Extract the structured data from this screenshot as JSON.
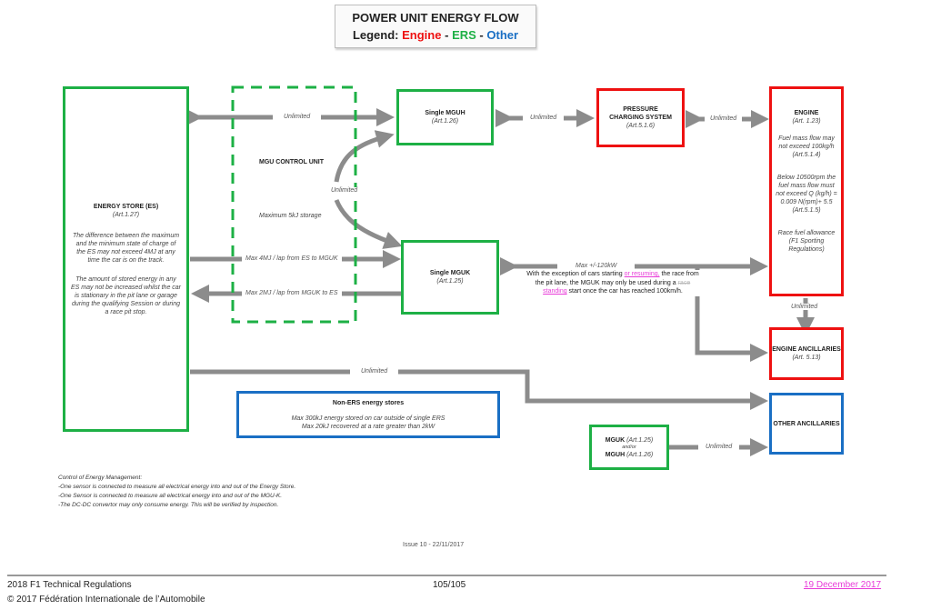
{
  "header": {
    "title": "POWER UNIT ENERGY FLOW",
    "legend_label": "Legend:",
    "legend_engine": "Engine",
    "legend_ers": "ERS",
    "legend_other": "Other",
    "separator": "-",
    "colors": {
      "engine": "#ee1111",
      "ers": "#1db045",
      "other": "#1a6fc4",
      "arrow": "#8c8c8c"
    }
  },
  "nodes": {
    "energy_store": {
      "title": "ENERGY STORE (ES)",
      "article": "(Art.1.27)",
      "note1": "The difference between the maximum and the minimum state of charge of the ES may not exceed 4MJ at any time the car is on the track.",
      "note2": "The amount of stored energy in any ES may not be increased whilst the car is stationary in the pit lane or garage during the qualifying Session or during a race pit stop."
    },
    "mgu_control_unit": {
      "title": "MGU CONTROL UNIT",
      "note": "Maximum 5kJ storage"
    },
    "mguh": {
      "title": "Single MGUH",
      "article": "(Art.1.26)"
    },
    "mguk": {
      "title": "Single MGUK",
      "article": "(Art.1.25)"
    },
    "pressure_charging": {
      "title": "PRESSURE CHARGING SYSTEM",
      "article": "(Art.5.1.6)"
    },
    "engine": {
      "title": "ENGINE",
      "article": "(Art. 1.23)",
      "note1": "Fuel mass flow may not exceed 100kg/h (Art.5.1.4)",
      "note2": "Below 10500rpm the fuel mass flow must not exceed Q (kg/h) = 0.009 N(rpm)+ 5.5 (Art.5.1.5)",
      "note3": "Race fuel allowance (F1 Sporting Regulations)"
    },
    "engine_ancillaries": {
      "title": "ENGINE ANCILLARIES",
      "article": "(Art. 5.13)"
    },
    "non_ers": {
      "title": "Non-ERS energy stores",
      "line1": "Max 300kJ energy stored on car outside of single ERS",
      "line2": "Max 20kJ recovered at a rate greater than 2kW"
    },
    "other_ancillaries": {
      "title": "OTHER ANCILLARIES"
    },
    "mguk_mguh": {
      "mguk": "MGUK",
      "mguk_art": "(Art.1.25)",
      "andor": "and/or",
      "mguh": "MGUH",
      "mguh_art": "(Art.1.26)"
    }
  },
  "flows": {
    "es_mguh": "Unlimited",
    "mguh_mguk": "Unlimited",
    "es_to_mguk": "Max 4MJ / lap from ES to MGUK",
    "mguk_to_es": "Max 2MJ / lap from MGUK to ES",
    "mguh_pcs": "Unlimited",
    "pcs_engine": "Unlimited",
    "mguk_engine": "Max +/-120kW",
    "mguk_note_a": "With the exception of cars starting ",
    "mguk_note_ins1": "or resuming,",
    "mguk_note_b": " the race from the pit lane, the MGUK may only be used during a ",
    "mguk_note_del": "race",
    "mguk_note_ins2": "standing",
    "mguk_note_c": " start once the car has reached 100km/h.",
    "engine_ancillaries": "Unlimited",
    "es_other": "Unlimited",
    "mgu_other": "Unlimited"
  },
  "notes": {
    "title": "Control of Energy Management:",
    "lines": [
      "-One sensor is connected to measure all electrical energy into and out of the Energy Store.",
      "-One Sensor is connected to measure all electrical energy into and out of the MGU-K.",
      "-The DC-DC convertor may only consume energy.  This will be verified by inspection."
    ]
  },
  "issue": "Issue 10 - 22/11/2017",
  "footer": {
    "doc_title": "2018 F1 Technical Regulations",
    "page": "105/105",
    "date": "19 December 2017",
    "copyright": "© 2017 Fédération Internationale de l’Automobile"
  }
}
